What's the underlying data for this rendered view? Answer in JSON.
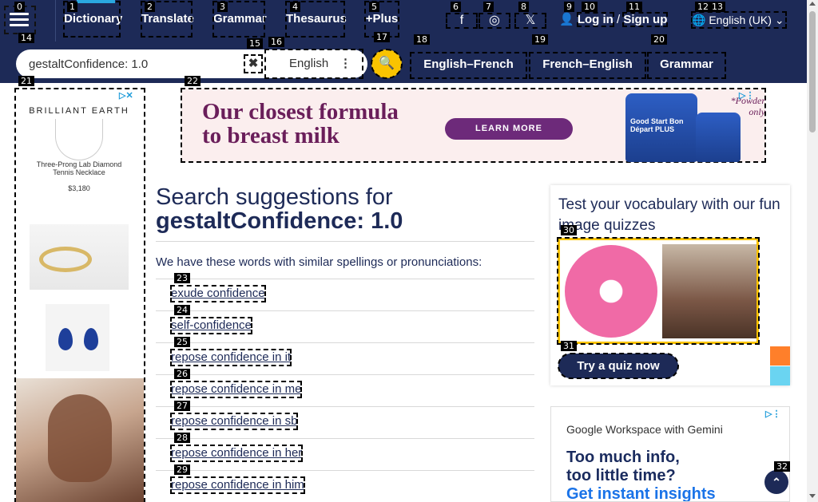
{
  "nav": {
    "links": [
      "Dictionary",
      "Translate",
      "Grammar",
      "Thesaurus",
      "+Plus"
    ],
    "login": "Log in",
    "slash": "/",
    "signup": "Sign up",
    "language": "English (UK)"
  },
  "search": {
    "value": "gestaltConfidence: 1.0",
    "lang": "English",
    "quick_links": [
      "English–French",
      "French–English",
      "Grammar"
    ]
  },
  "ads": {
    "left_brand": "BRILLIANT EARTH",
    "left_product": "Three-Prong Lab Diamond Tennis Necklace",
    "left_price": "$3,180",
    "banner_line1": "Our closest formula",
    "banner_line2": "to breast milk",
    "banner_cta": "LEARN MORE",
    "banner_can": "Good Start Bon Départ PLUS",
    "banner_small": "*Powder only",
    "google_head": "Google Workspace with Gemini",
    "google_line1": "Too much info,",
    "google_line2": "too little time?",
    "google_line3": "Get instant insights"
  },
  "main": {
    "title_prefix": "Search suggestions for",
    "title_query": "gestaltConfidence: 1.0",
    "intro": "We have these words with similar spellings or pronunciations:",
    "suggestions": [
      "exude confidence",
      "self-confidence",
      "repose confidence in it",
      "repose confidence in me",
      "repose confidence in sb",
      "repose confidence in her",
      "repose confidence in him"
    ]
  },
  "quiz": {
    "title": "Test your vocabulary with our fun image quizzes",
    "button": "Try a quiz now"
  },
  "tags": [
    "0",
    "1",
    "2",
    "3",
    "4",
    "5",
    "6",
    "7",
    "8",
    "9",
    "10",
    "11",
    "12",
    "13",
    "14",
    "15",
    "16",
    "17",
    "18",
    "19",
    "20",
    "21",
    "22",
    "23",
    "24",
    "25",
    "26",
    "27",
    "28",
    "29",
    "30",
    "31",
    "32"
  ],
  "colors": {
    "nav_bg": "#1d2a57",
    "accent_yellow": "#f9c300",
    "active_bar": "#2aa8e0"
  }
}
